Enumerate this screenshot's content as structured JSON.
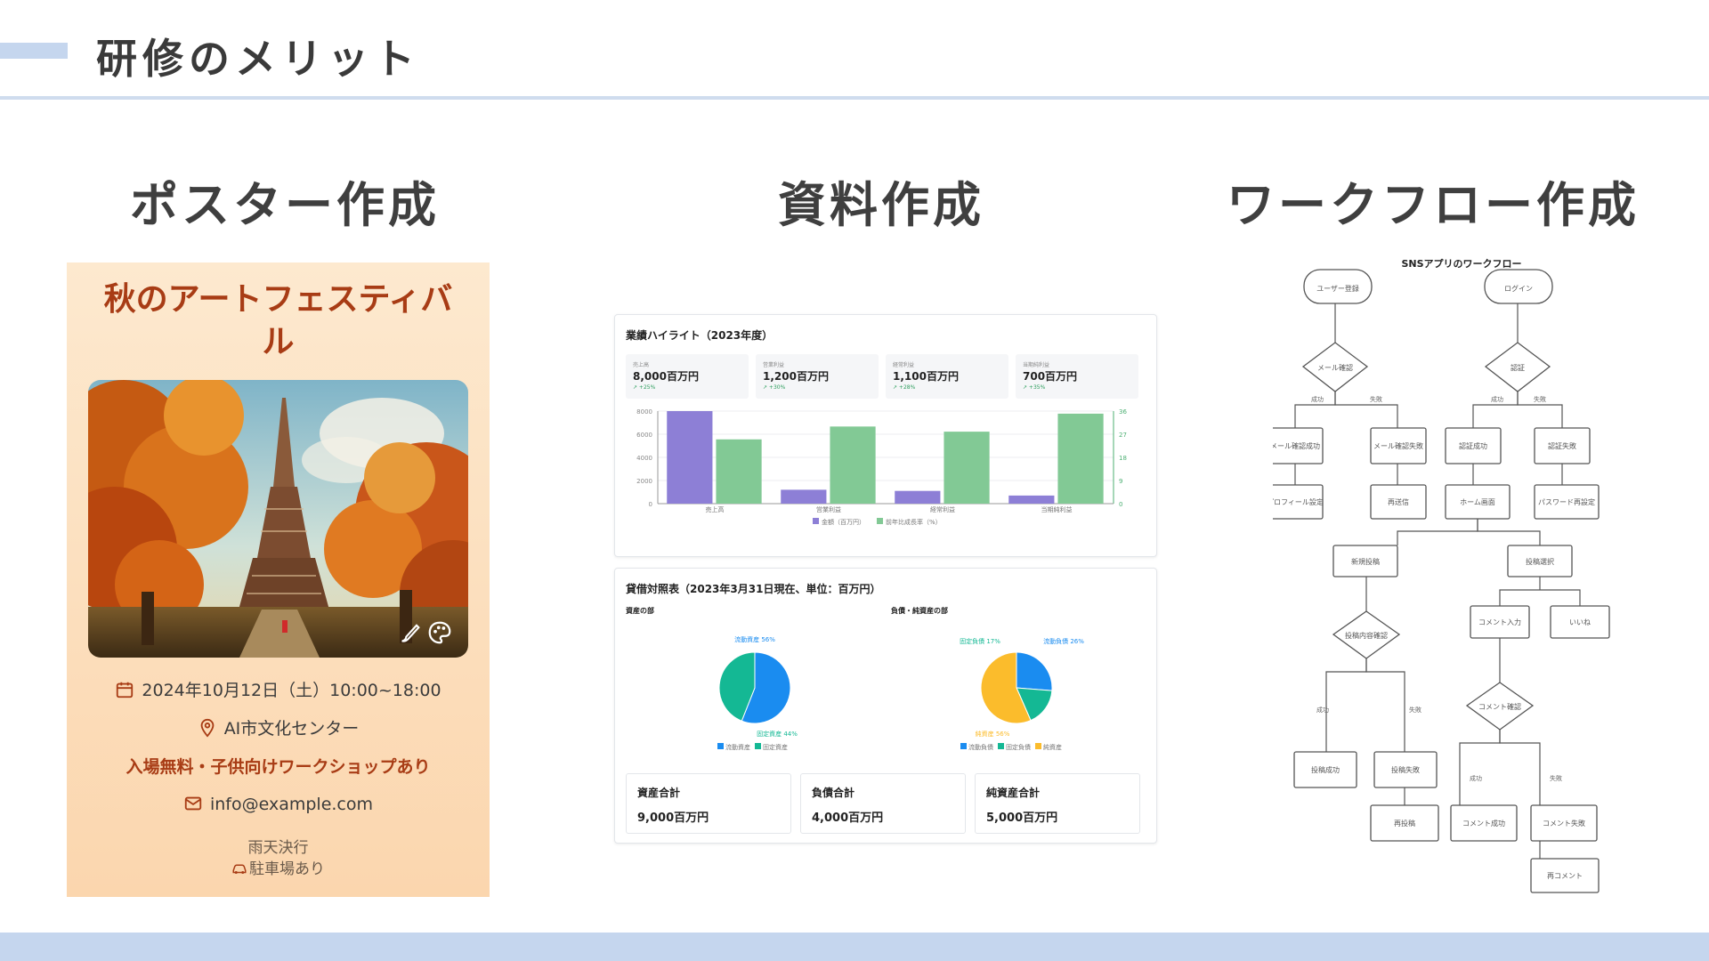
{
  "slide": {
    "title": "研修のメリット",
    "columns": [
      "ポスター作成",
      "資料作成",
      "ワークフロー作成"
    ]
  },
  "poster": {
    "title_line1": "秋のアートフェスティバ",
    "title_line2": "ル",
    "date": "2024年10月12日（土）10:00~18:00",
    "venue": "AI市文化センター",
    "note": "入場無料・子供向けワークショップあり",
    "email": "info@example.com",
    "rain": "雨天決行",
    "parking": "駐車場あり",
    "icons": [
      "calendar-icon",
      "location-pin-icon",
      "mail-icon",
      "car-icon",
      "brush-icon",
      "palette-icon"
    ]
  },
  "report": {
    "highlight_title": "業績ハイライト（2023年度）",
    "kpis": [
      {
        "label": "売上高",
        "value": "8,000百万円",
        "change": "↗ +25%"
      },
      {
        "label": "営業利益",
        "value": "1,200百万円",
        "change": "↗ +30%"
      },
      {
        "label": "経常利益",
        "value": "1,100百万円",
        "change": "↗ +28%"
      },
      {
        "label": "当期純利益",
        "value": "700百万円",
        "change": "↗ +35%"
      }
    ],
    "balance_title": "貸借対照表（2023年3月31日現在、単位：百万円）",
    "assets_label": "資産の部",
    "liabilities_label": "負債・純資産の部",
    "totals": [
      {
        "label": "資産合計",
        "value": "9,000百万円"
      },
      {
        "label": "負債合計",
        "value": "4,000百万円"
      },
      {
        "label": "純資産合計",
        "value": "5,000百万円"
      }
    ]
  },
  "chart_data": [
    {
      "type": "bar",
      "categories": [
        "売上高",
        "営業利益",
        "経常利益",
        "当期純利益"
      ],
      "series": [
        {
          "name": "金額（百万円）",
          "values": [
            8000,
            1200,
            1100,
            700
          ],
          "color": "#8d7fd6",
          "axis": "left"
        },
        {
          "name": "前年比成長率（%）",
          "values": [
            25,
            30,
            28,
            35
          ],
          "color": "#82c995",
          "axis": "right"
        }
      ],
      "ylim": [
        0,
        8000
      ],
      "yticks": [
        0,
        2000,
        4000,
        6000,
        8000
      ],
      "y2lim": [
        0,
        36
      ],
      "y2ticks": [
        0,
        9,
        18,
        27,
        36
      ],
      "grid": true,
      "legend": "bottom"
    },
    {
      "type": "pie",
      "categories": [
        "流動資産",
        "固定資産"
      ],
      "values": [
        56,
        44
      ],
      "labels": [
        "流動資産 56%",
        "固定資産 44%"
      ],
      "colors": [
        "#1a8cf0",
        "#14b894"
      ],
      "legend": "bottom"
    },
    {
      "type": "pie",
      "categories": [
        "流動負債",
        "固定負債",
        "純資産"
      ],
      "values": [
        26,
        17,
        56
      ],
      "labels": [
        "流動負債 26%",
        "固定負債 17%",
        "純資産 56%"
      ],
      "colors": [
        "#1a8cf0",
        "#14b894",
        "#fbbc2c"
      ],
      "legend": "bottom"
    }
  ],
  "workflow": {
    "title": "SNSアプリのワークフロー",
    "nodes": {
      "register": "ユーザー登録",
      "login": "ログイン",
      "mail_check": "メール確認",
      "auth": "認証",
      "mail_ok": "メール確認成功",
      "mail_ng": "メール確認失敗",
      "auth_ok": "認証成功",
      "auth_ng": "認証失敗",
      "profile": "プロフィール設定",
      "resend": "再送信",
      "home": "ホーム画面",
      "pw_reset": "パスワード再設定",
      "new_post": "新規投稿",
      "select_post": "投稿選択",
      "post_check": "投稿内容確認",
      "comment_input": "コメント入力",
      "like": "いいね",
      "comment_check": "コメント確認",
      "post_ok": "投稿成功",
      "post_ng": "投稿失敗",
      "repost": "再投稿",
      "comment_ok": "コメント成功",
      "comment_ng": "コメント失敗",
      "recomment": "再コメント"
    },
    "edges": {
      "success": "成功",
      "fail": "失敗"
    }
  },
  "colors": {
    "accent_band": "#c5d6ee",
    "poster_title": "#a83c15",
    "bar_amount": "#8d7fd6",
    "bar_growth": "#82c995"
  }
}
